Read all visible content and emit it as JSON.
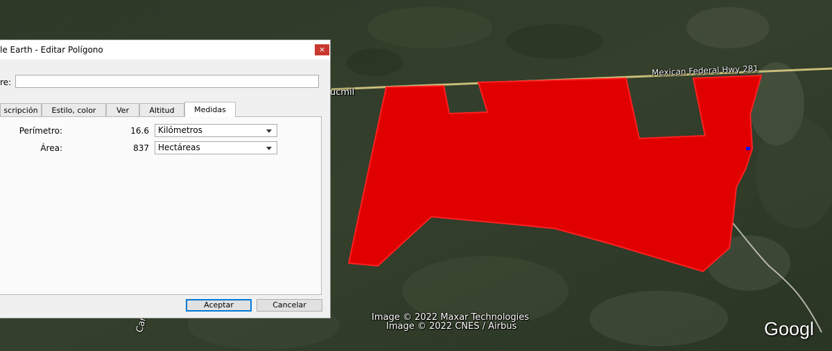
{
  "window": {
    "title": "le Earth - Editar Polígono",
    "close_glyph": "×"
  },
  "name_field": {
    "label": "re:",
    "value": ""
  },
  "tabs": [
    {
      "label": "scripción",
      "active": false
    },
    {
      "label": "Estilo, color",
      "active": false
    },
    {
      "label": "Ver",
      "active": false
    },
    {
      "label": "Altitud",
      "active": false
    },
    {
      "label": "Medidas",
      "active": true
    }
  ],
  "measurements": {
    "perimeter": {
      "label": "Perímetro:",
      "value": "16.6",
      "unit": "Kilómetros"
    },
    "area": {
      "label": "Área:",
      "value": "837",
      "unit": "Hectáreas"
    }
  },
  "buttons": {
    "ok": "Aceptar",
    "cancel": "Cancelar"
  },
  "map": {
    "road_label": "Mexican Federal Hwy 281",
    "town_label": "ucmil",
    "road_label_2": "Carr",
    "copyright_1": "Image © 2022 Maxar Technologies",
    "copyright_2": "Image © 2022 CNES / Airbus",
    "logo": "Googl",
    "polygon_color": "#e00000",
    "road_color": "#c9bd7a"
  }
}
